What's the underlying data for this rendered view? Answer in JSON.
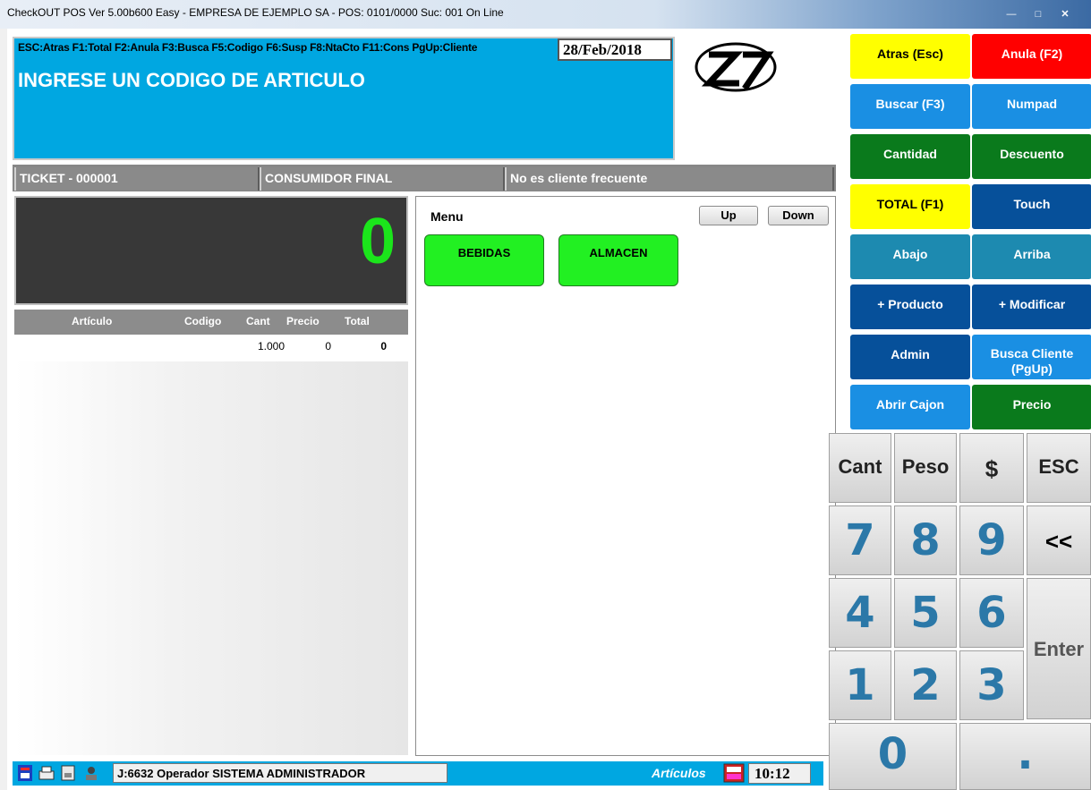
{
  "window": {
    "title": "CheckOUT POS Ver 5.00b600 Easy - EMPRESA DE EJEMPLO SA - POS: 0101/0000 Suc: 001  On Line"
  },
  "header": {
    "hotkeys": "ESC:Atras F1:Total F2:Anula F3:Busca F5:Codigo F6:Susp F8:NtaCto F11:Cons PgUp:Cliente",
    "date": "28/Feb/2018",
    "prompt": "INGRESE UN CODIGO DE ARTICULO"
  },
  "info": {
    "ticket": "TICKET - 000001",
    "customer": "CONSUMIDOR FINAL",
    "frequent": "No es cliente frecuente"
  },
  "display": {
    "total": "0"
  },
  "grid": {
    "columns": [
      "Artículo",
      "Codigo",
      "Cant",
      "Precio",
      "Total"
    ],
    "row": {
      "articulo": "",
      "codigo": "",
      "cant": "1.000",
      "precio": "0",
      "total": "0"
    }
  },
  "menu": {
    "title": "Menu",
    "up": "Up",
    "down": "Down",
    "categories": [
      "BEBIDAS",
      "ALMACEN"
    ]
  },
  "function_buttons": [
    {
      "label": "Atras (Esc)",
      "color": "#ffff00"
    },
    {
      "label": "Anula (F2)",
      "color": "#ff0000"
    },
    {
      "label": "Buscar (F3)",
      "color": "#1a8fe3"
    },
    {
      "label": "Numpad",
      "color": "#1a8fe3"
    },
    {
      "label": "Cantidad",
      "color": "#0a7a1c"
    },
    {
      "label": "Descuento",
      "color": "#0a7a1c"
    },
    {
      "label": "TOTAL (F1)",
      "color": "#ffff00"
    },
    {
      "label": "Touch",
      "color": "#06509a"
    },
    {
      "label": "Abajo",
      "color": "#1d8ab0"
    },
    {
      "label": "Arriba",
      "color": "#1d8ab0"
    },
    {
      "label": "+ Producto",
      "color": "#06509a"
    },
    {
      "label": "+ Modificar",
      "color": "#06509a"
    },
    {
      "label": "Admin",
      "color": "#06509a"
    },
    {
      "label": "Busca Cliente (PgUp)",
      "color": "#1a8fe3"
    },
    {
      "label": "Abrir Cajon",
      "color": "#1a8fe3"
    },
    {
      "label": "Precio",
      "color": "#0a7a1c"
    }
  ],
  "keypad": {
    "cant": "Cant",
    "peso": "Peso",
    "dollar": "$",
    "esc": "ESC",
    "k7": "7",
    "k8": "8",
    "k9": "9",
    "back": "<<",
    "k4": "4",
    "k5": "5",
    "k6": "6",
    "enter": "Enter",
    "k1": "1",
    "k2": "2",
    "k3": "3",
    "k0": "0",
    "dot": "."
  },
  "status": {
    "operator": "J:6632 Operador  SISTEMA ADMINISTRADOR",
    "articulos": "Artículos",
    "time": "10:12"
  }
}
